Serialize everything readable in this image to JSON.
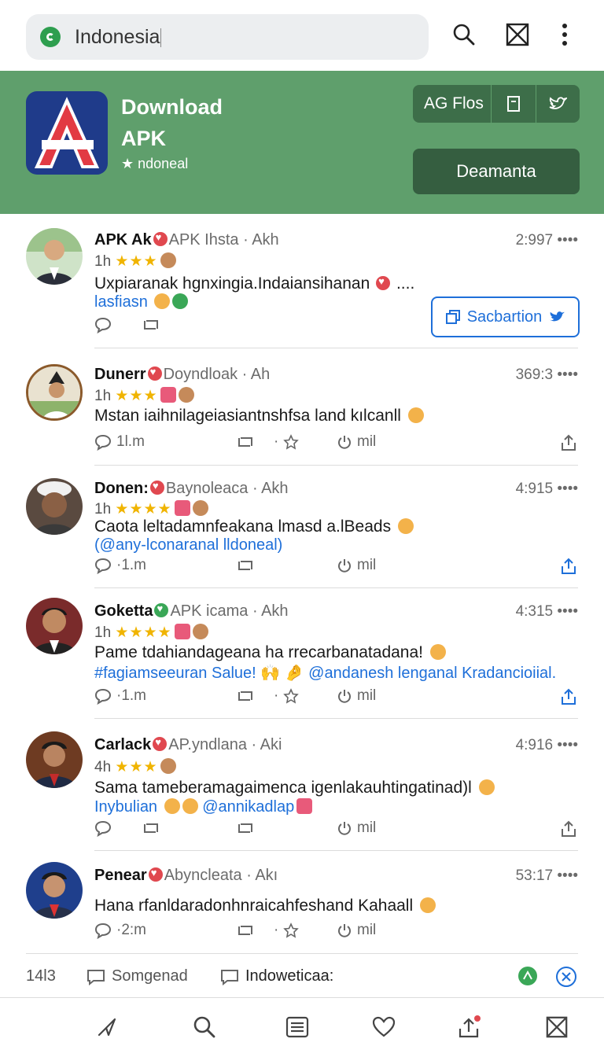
{
  "search": {
    "value": "Indonesia"
  },
  "banner": {
    "title_line1": "Download",
    "title_line2": "APK",
    "subtitle": "★ ndoneal",
    "seg_label": "AG Flos",
    "download_label": "Deamanta"
  },
  "colors": {
    "brand_green": "#5f9f6c",
    "dark_green": "#355e40",
    "link_blue": "#1e6fd9",
    "star": "#f0b400"
  },
  "posts": [
    {
      "name": "APK Ak",
      "handle": "APK Ihsta · Akh",
      "time": "2:997 ••••",
      "meta_time": "1h",
      "stars": "★★★",
      "text": "Uxpiaranak hgnxingia.Indaiansihanan",
      "text_suffix": "....",
      "link": "lasfiasn",
      "comment_count": "",
      "retweet_count": "",
      "like_count": "",
      "button": "Sacbartion"
    },
    {
      "name": "Dunerr",
      "handle": "Doyndloak · Ah",
      "time": "369:3 ••••",
      "meta_time": "1h",
      "stars": "★★★",
      "text": "Mstan iaihnilageiasiantnshfsa land kılcanll",
      "comment_count": "1l.m",
      "like_count": "mil"
    },
    {
      "name": "Donen:",
      "handle": "Baynoleaca · Akh",
      "time": "4:915 ••••",
      "meta_time": "1h",
      "stars": "★★★★",
      "text": "Caota leltadamnfeakana lmasd a.lBeads",
      "link": "(@any-lconaranal lldoneal)",
      "comment_count": "·1.m",
      "like_count": "mil"
    },
    {
      "name": "Goketta",
      "handle": "APK icama · Akh",
      "time": "4:315 ••••",
      "meta_time": "1h",
      "stars": "★★★★",
      "text": "Pame tdahiandageana ha rrecarbanatadana!",
      "link": "#fagiamseeuran Salue! 🙌 🤌 @andanesh lenganal Kradancioiial.",
      "comment_count": "·1.m",
      "like_count": "mil"
    },
    {
      "name": "Carlack",
      "handle": "AP.yndlana · Aki",
      "time": "4:916 ••••",
      "meta_time": "4h",
      "stars": "★★★",
      "text": "Sama tameberamagaimenca igenlakauhtingatinad)l",
      "link": "Inybulian",
      "link2": "@annikadlap",
      "like_count": "mil"
    },
    {
      "name": "Penear",
      "handle": "Abyncleata · Akı",
      "time": "53:17 ••••",
      "text": "Hana rfanldaradonhnraicahfeshand Kahaall",
      "comment_count": "·2:m",
      "like_count": "mil"
    }
  ],
  "strip": {
    "count": "14l3",
    "item1": "Somgenad",
    "item2": "Indoweticaa:"
  },
  "icons": [
    "search-icon",
    "close-box-icon",
    "more-vert-icon",
    "comment-icon",
    "retweet-icon",
    "star-icon",
    "power-icon",
    "share-icon",
    "nav-send-icon",
    "nav-search-icon",
    "nav-list-icon",
    "nav-heart-icon",
    "nav-upload-icon",
    "nav-close-box-icon"
  ]
}
